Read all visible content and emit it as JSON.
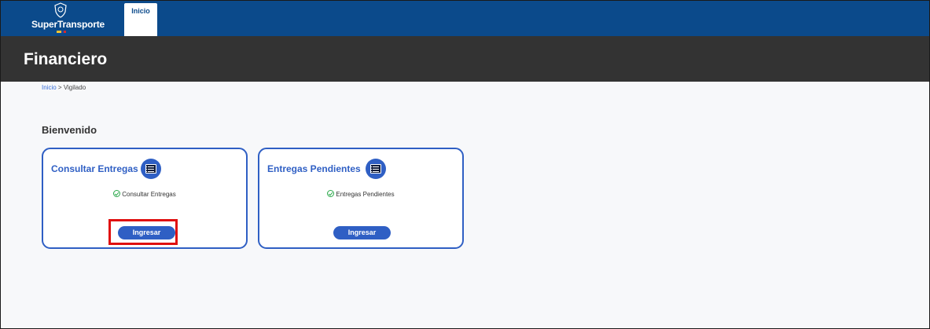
{
  "header": {
    "logo_text": "SuperTransporte",
    "nav_tab": "Inicio"
  },
  "page": {
    "title": "Financiero"
  },
  "breadcrumb": {
    "home": "Inicio",
    "separator": ">",
    "current": "Vigilado"
  },
  "welcome": "Bienvenido",
  "cards": [
    {
      "title": "Consultar Entregas",
      "icon": "list-icon",
      "check_label": "Consultar Entregas",
      "button_label": "Ingresar"
    },
    {
      "title": "Entregas Pendientes",
      "icon": "list-icon",
      "check_label": "Entregas Pendientes",
      "button_label": "Ingresar"
    }
  ],
  "colors": {
    "topbar": "#0b4a8b",
    "titlebar": "#333333",
    "accent": "#2f5fc4",
    "check": "#2aa84a",
    "highlight": "#e01010"
  }
}
